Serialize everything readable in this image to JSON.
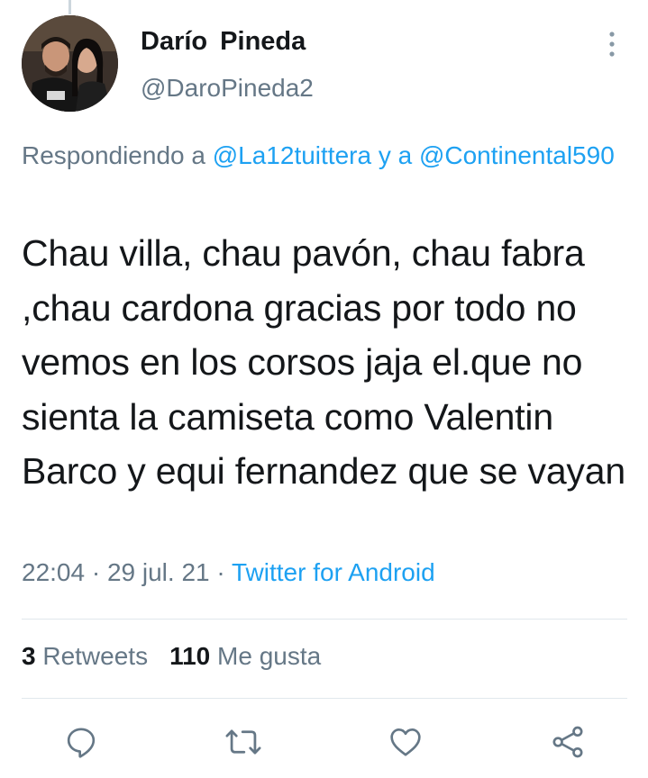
{
  "author": {
    "name": "Darío  Pineda",
    "handle": "@DaroPineda2"
  },
  "reply": {
    "prefix": "Respondiendo a ",
    "mention_1": "@La12tuittera",
    "conjunction": " y a ",
    "mention_2": "@Continental590"
  },
  "tweet": {
    "text": "Chau villa, chau pavón, chau fabra ,chau cardona gracias por todo no vemos en los corsos jaja el.que no sienta la camiseta como Valentin Barco y equi fernandez que se vayan",
    "time": "22:04",
    "separator": " · ",
    "date": "29 jul. 21",
    "source": "Twitter for Android"
  },
  "stats": {
    "retweets_count": "3",
    "retweets_label": "Retweets",
    "likes_count": "110",
    "likes_label": "Me gusta"
  },
  "actions": {
    "icons": [
      "reply-icon",
      "retweet-icon",
      "like-icon",
      "share-icon"
    ]
  },
  "colors": {
    "text": "#14171a",
    "secondary": "#657786",
    "accent": "#1da1f2",
    "divider": "#e1e8ed"
  }
}
